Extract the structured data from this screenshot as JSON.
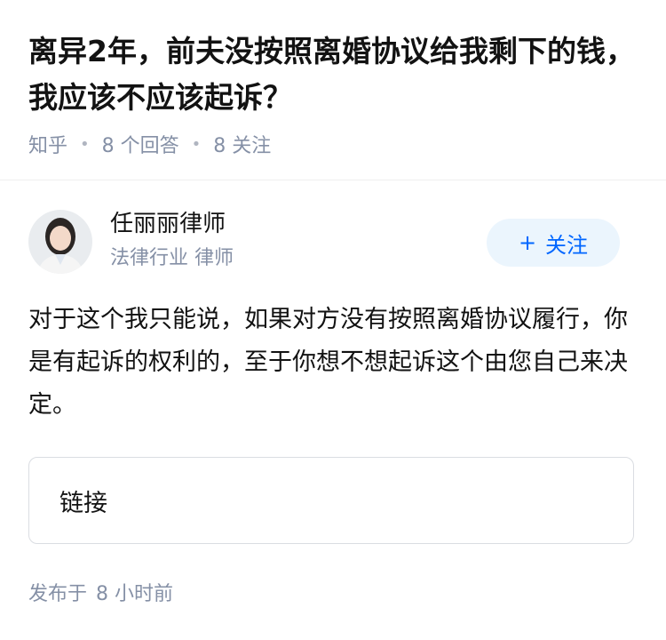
{
  "question": {
    "title": "离异2年，前夫没按照离婚协议给我剩下的钱，我应该不应该起诉？",
    "source": "知乎",
    "answers_count": "8 个回答",
    "followers_count": "8 关注"
  },
  "author": {
    "name": "任丽丽律师",
    "description": "法律行业 律师",
    "follow_icon": "+",
    "follow_label": "关注"
  },
  "answer": {
    "content": "对于这个我只能说，如果对方没有按照离婚协议履行，你是有起诉的权利的，至于你想不想起诉这个由您自己来决定。",
    "link_label": "链接"
  },
  "footer": {
    "published_label": "发布于",
    "published_time": "8 小时前"
  },
  "colors": {
    "accent": "#0066ff",
    "meta_gray": "#8590a6",
    "follow_bg": "#ebf5fd"
  }
}
